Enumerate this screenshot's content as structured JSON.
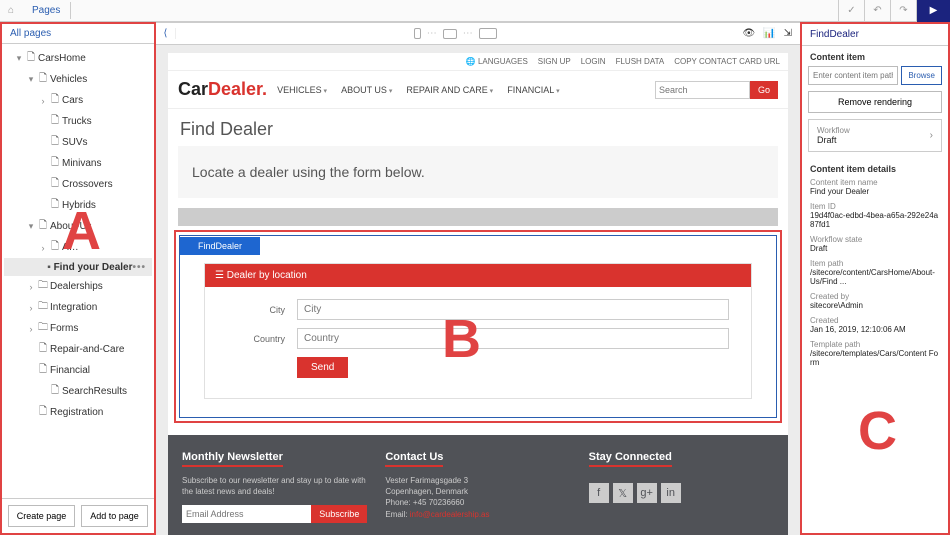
{
  "ribbon": {
    "home": "⌂",
    "tab": "Pages",
    "check": "✓",
    "undo": "↶",
    "redo": "↷",
    "play": "▶"
  },
  "tree": {
    "header": "All pages",
    "root": "CarsHome",
    "vehicles": "Vehicles",
    "cars": "Cars",
    "trucks": "Trucks",
    "suvs": "SUVs",
    "minivans": "Minivans",
    "crossovers": "Crossovers",
    "hybrids": "Hybrids",
    "about": "About-Us",
    "about_child": "A…",
    "find_dealer": "Find your Dealer",
    "dealerships": "Dealerships",
    "integration": "Integration",
    "forms": "Forms",
    "repair": "Repair-and-Care",
    "financial": "Financial",
    "search_results": "SearchResults",
    "registration": "Registration",
    "create_page": "Create page",
    "add_to_page": "Add to page"
  },
  "center_toolbar": {
    "back": "⟨",
    "eye": "👁",
    "stats": "📊",
    "export": "⇲"
  },
  "page": {
    "top": {
      "languages": "🌐 LANGUAGES",
      "signup": "SIGN UP",
      "login": "LOGIN",
      "flush": "FLUSH DATA",
      "copy": "COPY CONTACT CARD URL"
    },
    "logo_a": "Car",
    "logo_b": "Dealer.",
    "nav": {
      "vehicles": "VEHICLES",
      "about": "ABOUT US",
      "repair": "REPAIR AND CARE",
      "financial": "FINANCIAL"
    },
    "search_placeholder": "Search",
    "go": "Go",
    "title": "Find Dealer",
    "subtitle": "Locate a dealer using the form below.",
    "rendering_name": "FindDealer",
    "form": {
      "heading": "Dealer by location",
      "city_label": "City",
      "city_placeholder": "City",
      "country_label": "Country",
      "country_placeholder": "Country",
      "send": "Send"
    },
    "footer": {
      "col1_title": "Monthly Newsletter",
      "col1_text": "Subscribe to our newsletter and stay up to date with the latest news and deals!",
      "col1_placeholder": "Email Address",
      "col1_btn": "Subscribe",
      "col2_title": "Contact Us",
      "col2_addr1": "Vester Farimagsgade 3",
      "col2_addr2": "Copenhagen, Denmark",
      "col2_phone": "Phone: +45 70236660",
      "col2_email_label": "Email: ",
      "col2_email": "info@cardealership.as",
      "col3_title": "Stay Connected",
      "social": {
        "fb": "f",
        "tw": "𝕏",
        "gp": "g+",
        "in": "in"
      }
    }
  },
  "right": {
    "title": "FindDealer",
    "content_item": "Content item",
    "path_placeholder": "Enter content item path",
    "browse": "Browse",
    "remove": "Remove rendering",
    "workflow_label": "Workflow",
    "workflow_value": "Draft",
    "details_header": "Content item details",
    "name_k": "Content item name",
    "name_v": "Find your Dealer",
    "id_k": "Item ID",
    "id_v": "19d4f0ac-edbd-4bea-a65a-292e24a87fd1",
    "wf_k": "Workflow state",
    "wf_v": "Draft",
    "path_k": "Item path",
    "path_v": "/sitecore/content/CarsHome/About-Us/Find ...",
    "createdby_k": "Created by",
    "createdby_v": "sitecore\\Admin",
    "created_k": "Created",
    "created_v": "Jan 16, 2019, 12:10:06 AM",
    "tpl_k": "Template path",
    "tpl_v": "/sitecore/templates/Cars/Content Form"
  },
  "annotations": {
    "a": "A",
    "b": "B",
    "c": "C"
  }
}
